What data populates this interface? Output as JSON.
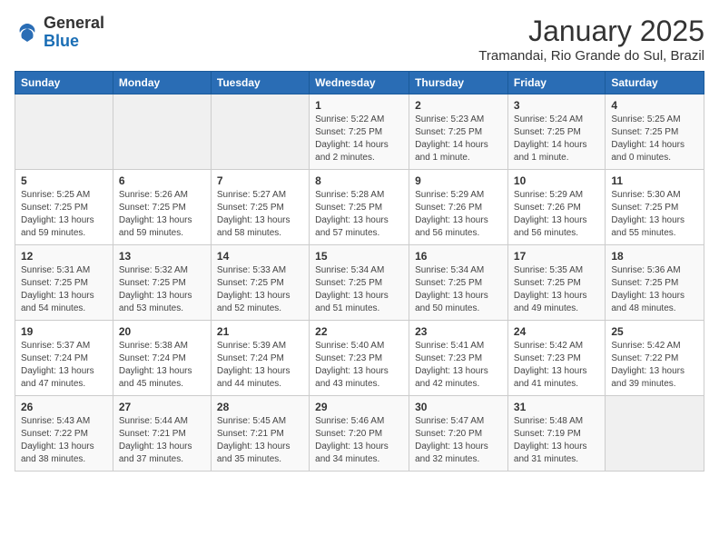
{
  "header": {
    "logo_general": "General",
    "logo_blue": "Blue",
    "month_year": "January 2025",
    "location": "Tramandai, Rio Grande do Sul, Brazil"
  },
  "days_of_week": [
    "Sunday",
    "Monday",
    "Tuesday",
    "Wednesday",
    "Thursday",
    "Friday",
    "Saturday"
  ],
  "weeks": [
    [
      {
        "day": "",
        "info": ""
      },
      {
        "day": "",
        "info": ""
      },
      {
        "day": "",
        "info": ""
      },
      {
        "day": "1",
        "info": "Sunrise: 5:22 AM\nSunset: 7:25 PM\nDaylight: 14 hours\nand 2 minutes."
      },
      {
        "day": "2",
        "info": "Sunrise: 5:23 AM\nSunset: 7:25 PM\nDaylight: 14 hours\nand 1 minute."
      },
      {
        "day": "3",
        "info": "Sunrise: 5:24 AM\nSunset: 7:25 PM\nDaylight: 14 hours\nand 1 minute."
      },
      {
        "day": "4",
        "info": "Sunrise: 5:25 AM\nSunset: 7:25 PM\nDaylight: 14 hours\nand 0 minutes."
      }
    ],
    [
      {
        "day": "5",
        "info": "Sunrise: 5:25 AM\nSunset: 7:25 PM\nDaylight: 13 hours\nand 59 minutes."
      },
      {
        "day": "6",
        "info": "Sunrise: 5:26 AM\nSunset: 7:25 PM\nDaylight: 13 hours\nand 59 minutes."
      },
      {
        "day": "7",
        "info": "Sunrise: 5:27 AM\nSunset: 7:25 PM\nDaylight: 13 hours\nand 58 minutes."
      },
      {
        "day": "8",
        "info": "Sunrise: 5:28 AM\nSunset: 7:25 PM\nDaylight: 13 hours\nand 57 minutes."
      },
      {
        "day": "9",
        "info": "Sunrise: 5:29 AM\nSunset: 7:26 PM\nDaylight: 13 hours\nand 56 minutes."
      },
      {
        "day": "10",
        "info": "Sunrise: 5:29 AM\nSunset: 7:26 PM\nDaylight: 13 hours\nand 56 minutes."
      },
      {
        "day": "11",
        "info": "Sunrise: 5:30 AM\nSunset: 7:25 PM\nDaylight: 13 hours\nand 55 minutes."
      }
    ],
    [
      {
        "day": "12",
        "info": "Sunrise: 5:31 AM\nSunset: 7:25 PM\nDaylight: 13 hours\nand 54 minutes."
      },
      {
        "day": "13",
        "info": "Sunrise: 5:32 AM\nSunset: 7:25 PM\nDaylight: 13 hours\nand 53 minutes."
      },
      {
        "day": "14",
        "info": "Sunrise: 5:33 AM\nSunset: 7:25 PM\nDaylight: 13 hours\nand 52 minutes."
      },
      {
        "day": "15",
        "info": "Sunrise: 5:34 AM\nSunset: 7:25 PM\nDaylight: 13 hours\nand 51 minutes."
      },
      {
        "day": "16",
        "info": "Sunrise: 5:34 AM\nSunset: 7:25 PM\nDaylight: 13 hours\nand 50 minutes."
      },
      {
        "day": "17",
        "info": "Sunrise: 5:35 AM\nSunset: 7:25 PM\nDaylight: 13 hours\nand 49 minutes."
      },
      {
        "day": "18",
        "info": "Sunrise: 5:36 AM\nSunset: 7:25 PM\nDaylight: 13 hours\nand 48 minutes."
      }
    ],
    [
      {
        "day": "19",
        "info": "Sunrise: 5:37 AM\nSunset: 7:24 PM\nDaylight: 13 hours\nand 47 minutes."
      },
      {
        "day": "20",
        "info": "Sunrise: 5:38 AM\nSunset: 7:24 PM\nDaylight: 13 hours\nand 45 minutes."
      },
      {
        "day": "21",
        "info": "Sunrise: 5:39 AM\nSunset: 7:24 PM\nDaylight: 13 hours\nand 44 minutes."
      },
      {
        "day": "22",
        "info": "Sunrise: 5:40 AM\nSunset: 7:23 PM\nDaylight: 13 hours\nand 43 minutes."
      },
      {
        "day": "23",
        "info": "Sunrise: 5:41 AM\nSunset: 7:23 PM\nDaylight: 13 hours\nand 42 minutes."
      },
      {
        "day": "24",
        "info": "Sunrise: 5:42 AM\nSunset: 7:23 PM\nDaylight: 13 hours\nand 41 minutes."
      },
      {
        "day": "25",
        "info": "Sunrise: 5:42 AM\nSunset: 7:22 PM\nDaylight: 13 hours\nand 39 minutes."
      }
    ],
    [
      {
        "day": "26",
        "info": "Sunrise: 5:43 AM\nSunset: 7:22 PM\nDaylight: 13 hours\nand 38 minutes."
      },
      {
        "day": "27",
        "info": "Sunrise: 5:44 AM\nSunset: 7:21 PM\nDaylight: 13 hours\nand 37 minutes."
      },
      {
        "day": "28",
        "info": "Sunrise: 5:45 AM\nSunset: 7:21 PM\nDaylight: 13 hours\nand 35 minutes."
      },
      {
        "day": "29",
        "info": "Sunrise: 5:46 AM\nSunset: 7:20 PM\nDaylight: 13 hours\nand 34 minutes."
      },
      {
        "day": "30",
        "info": "Sunrise: 5:47 AM\nSunset: 7:20 PM\nDaylight: 13 hours\nand 32 minutes."
      },
      {
        "day": "31",
        "info": "Sunrise: 5:48 AM\nSunset: 7:19 PM\nDaylight: 13 hours\nand 31 minutes."
      },
      {
        "day": "",
        "info": ""
      }
    ]
  ]
}
